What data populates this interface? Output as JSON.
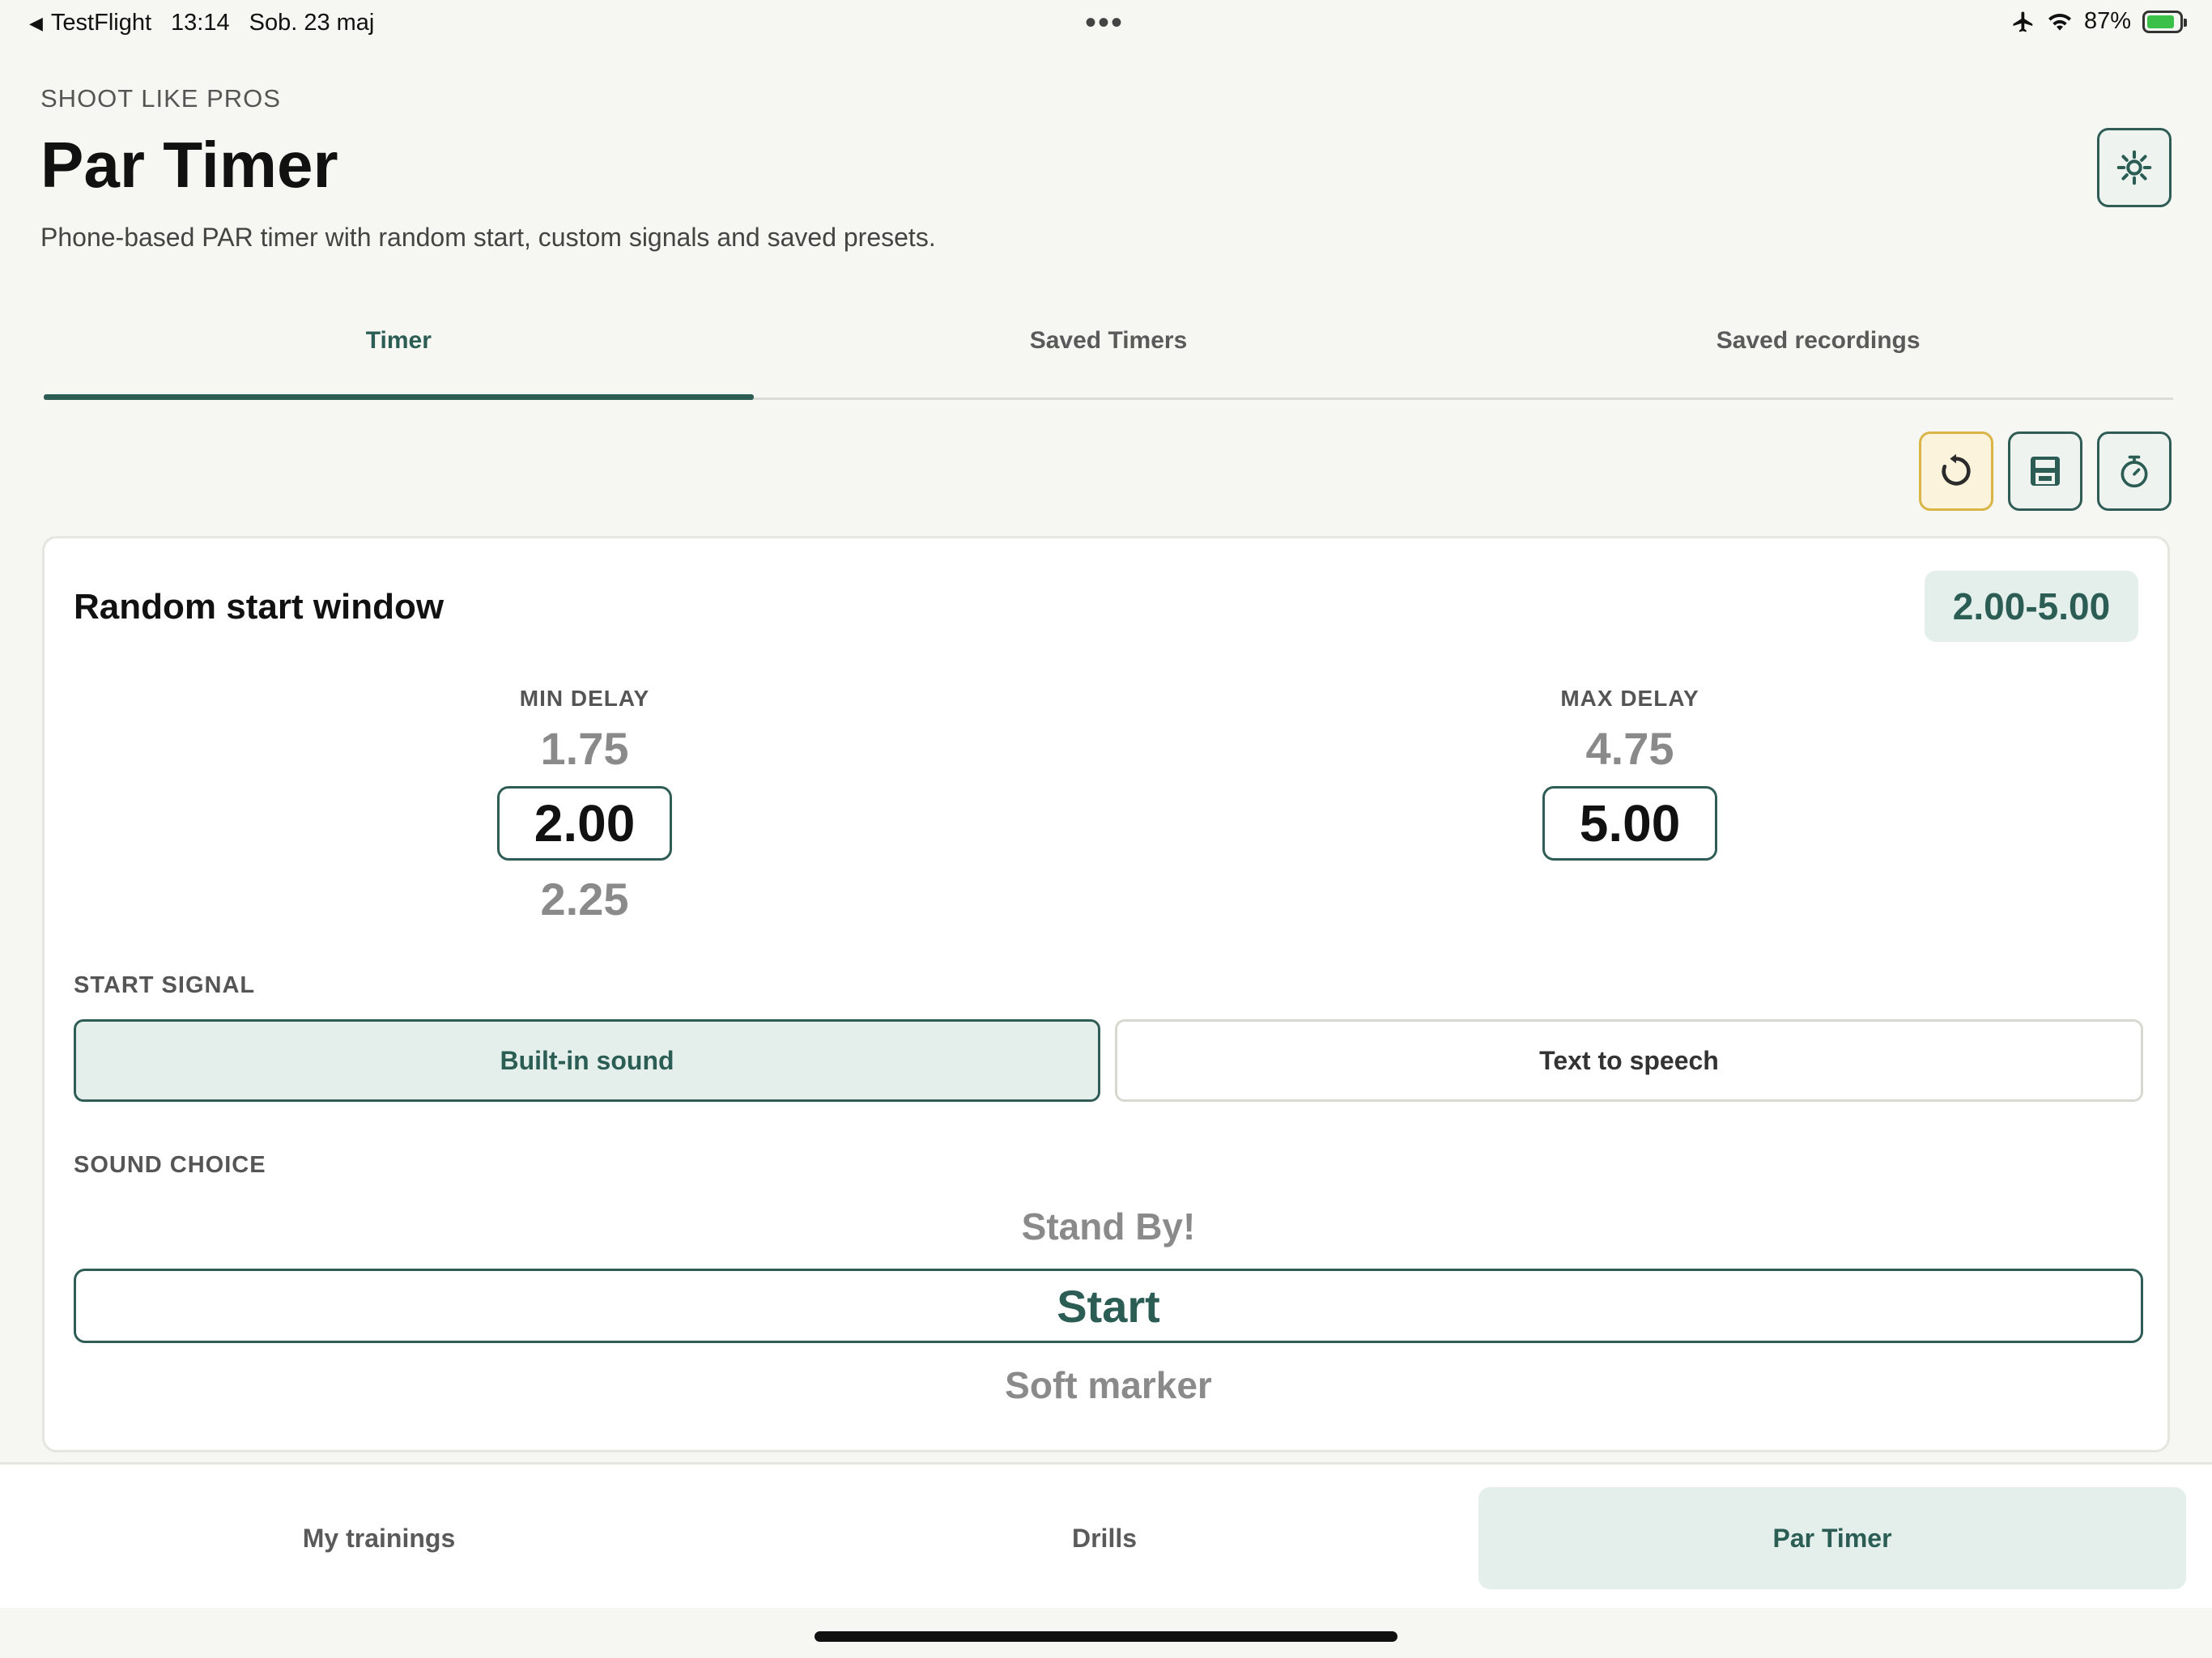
{
  "status_bar": {
    "back_app": "TestFlight",
    "time": "13:14",
    "date": "Sob. 23 maj",
    "battery": "87%",
    "battery_level": 0.87,
    "icons": [
      "airplane-icon",
      "wifi-icon",
      "battery-charging-icon"
    ]
  },
  "header": {
    "eyebrow": "SHOOT LIKE PROS",
    "title": "Par Timer",
    "subtitle": "Phone-based PAR timer with random start, custom signals and saved presets."
  },
  "tabs": [
    {
      "label": "Timer",
      "active": true
    },
    {
      "label": "Saved Timers",
      "active": false
    },
    {
      "label": "Saved recordings",
      "active": false
    }
  ],
  "tools": [
    "reset-icon",
    "save-icon",
    "stopwatch-icon"
  ],
  "card": {
    "title": "Random start window",
    "range": "2.00-5.00",
    "min_delay": {
      "label": "MIN DELAY",
      "prev": "1.75",
      "value": "2.00",
      "next": "2.25"
    },
    "max_delay": {
      "label": "MAX DELAY",
      "prev": "4.75",
      "value": "5.00",
      "next": ""
    },
    "start_signal": {
      "label": "START SIGNAL",
      "options": [
        {
          "label": "Built-in sound",
          "selected": true
        },
        {
          "label": "Text to speech",
          "selected": false
        }
      ]
    },
    "sound_choice": {
      "label": "SOUND CHOICE",
      "prev": "Stand By!",
      "value": "Start",
      "next": "Soft marker"
    }
  },
  "bottom_nav": [
    {
      "label": "My trainings",
      "active": false
    },
    {
      "label": "Drills",
      "active": false
    },
    {
      "label": "Par Timer",
      "active": true
    }
  ],
  "colors": {
    "accent": "#2b5d55",
    "accent_bg": "#e4efeb",
    "warning": "#d9b548",
    "background": "#f6f6f2"
  }
}
